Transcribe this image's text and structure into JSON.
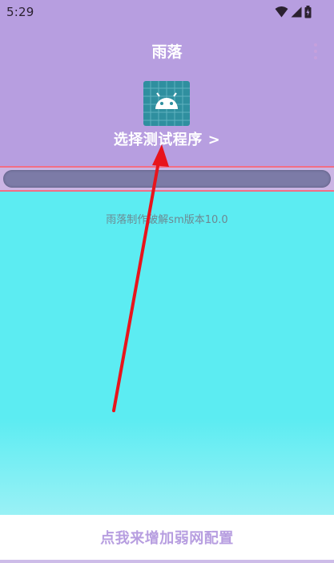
{
  "status_bar": {
    "time": "5:29",
    "icons": [
      "wifi-icon",
      "signal-icon",
      "battery-icon"
    ]
  },
  "header": {
    "title": "雨落",
    "menu_icon": "more-vert-icon",
    "app_icon": "android-icon",
    "select_label": "选择测试程序 >"
  },
  "main": {
    "version_text": "雨落制作破解sm版本10.0"
  },
  "footer": {
    "config_button_label": "点我来增加弱网配置"
  },
  "colors": {
    "header_bg": "#b79ee0",
    "main_bg": "#5cecf2",
    "progress_bar": "#7c7ba7",
    "progress_border": "#f16e86",
    "annotation_arrow": "#e8141c",
    "footer_text": "#b79ee0"
  }
}
